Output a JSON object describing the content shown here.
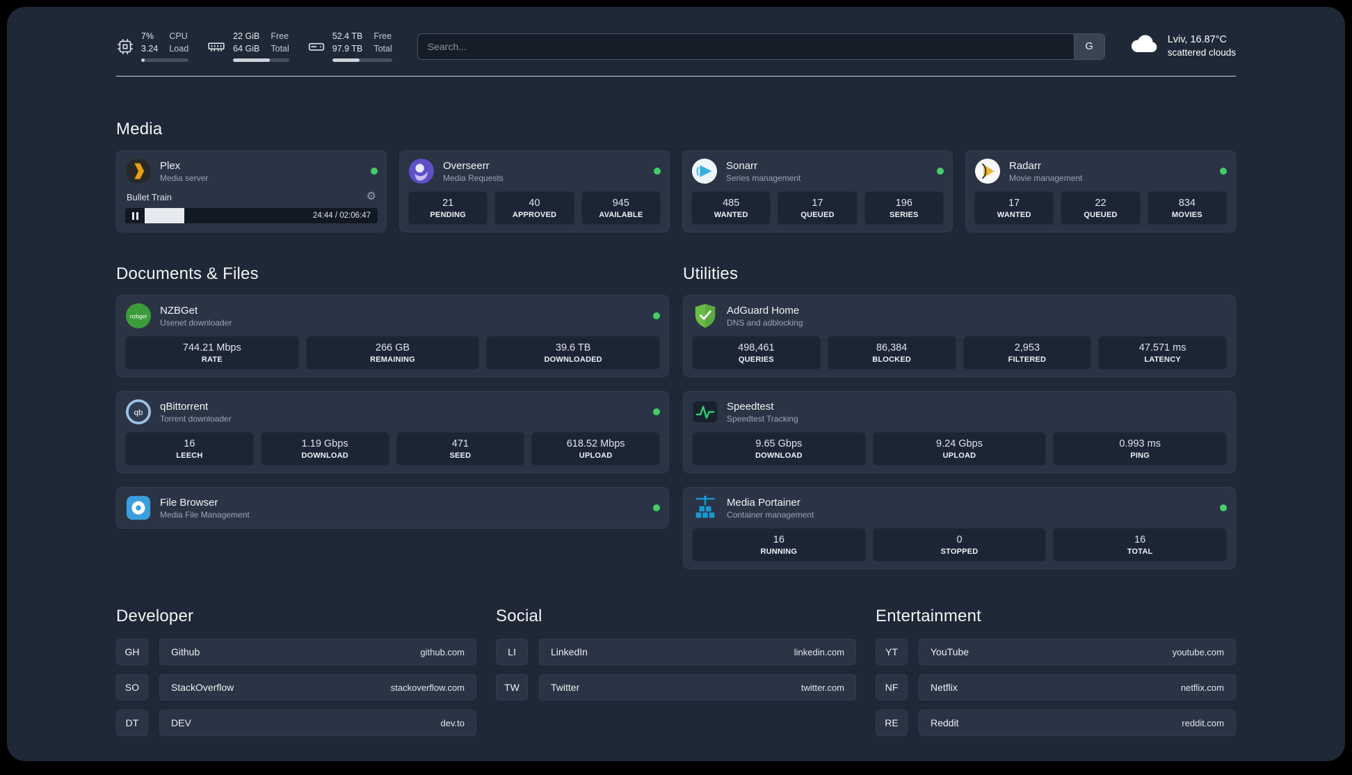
{
  "colors": {
    "page_bg": "#1e2836",
    "card_bg": "#2a3444",
    "tile_bg": "#1c2534",
    "status_green": "#44ce6b",
    "divider": "#cfd4db",
    "plex_gold": "#e5a00d",
    "adguard_green": "#68bc46",
    "portainer_blue": "#1999d4"
  },
  "icons": {
    "gear": "⚙"
  },
  "topbar": {
    "cpu": {
      "line1": "7%",
      "line2": "3.24",
      "label1": "CPU",
      "label2": "Load",
      "progress_pct": 7
    },
    "memory": {
      "line1": "22 GiB",
      "line2": "64 GiB",
      "label1": "Free",
      "label2": "Total",
      "progress_pct": 66
    },
    "disk": {
      "line1": "52.4 TB",
      "line2": "97.9 TB",
      "label1": "Free",
      "label2": "Total",
      "progress_pct": 46
    },
    "search": {
      "placeholder": "Search...",
      "button": "G"
    },
    "weather": {
      "location": "Lviv, 16.87°C",
      "condition": "scattered clouds"
    }
  },
  "sections": {
    "media": {
      "title": "Media",
      "plex": {
        "name": "Plex",
        "desc": "Media server",
        "now_playing": "Bullet Train",
        "time": "24:44 / 02:06:47",
        "progress_pct": 17
      },
      "overseerr": {
        "name": "Overseerr",
        "desc": "Media Requests",
        "stats": [
          {
            "value": "21",
            "label": "PENDING"
          },
          {
            "value": "40",
            "label": "APPROVED"
          },
          {
            "value": "945",
            "label": "AVAILABLE"
          }
        ]
      },
      "sonarr": {
        "name": "Sonarr",
        "desc": "Series management",
        "stats": [
          {
            "value": "485",
            "label": "WANTED"
          },
          {
            "value": "17",
            "label": "QUEUED"
          },
          {
            "value": "196",
            "label": "SERIES"
          }
        ]
      },
      "radarr": {
        "name": "Radarr",
        "desc": "Movie management",
        "stats": [
          {
            "value": "17",
            "label": "WANTED"
          },
          {
            "value": "22",
            "label": "QUEUED"
          },
          {
            "value": "834",
            "label": "MOVIES"
          }
        ]
      }
    },
    "documents": {
      "title": "Documents & Files",
      "nzbget": {
        "name": "NZBGet",
        "desc": "Usenet downloader",
        "stats": [
          {
            "value": "744.21 Mbps",
            "label": "RATE"
          },
          {
            "value": "266 GB",
            "label": "REMAINING"
          },
          {
            "value": "39.6 TB",
            "label": "DOWNLOADED"
          }
        ]
      },
      "qbittorrent": {
        "name": "qBittorrent",
        "desc": "Torrent downloader",
        "stats": [
          {
            "value": "16",
            "label": "LEECH"
          },
          {
            "value": "1.19 Gbps",
            "label": "DOWNLOAD"
          },
          {
            "value": "471",
            "label": "SEED"
          },
          {
            "value": "618.52 Mbps",
            "label": "UPLOAD"
          }
        ]
      },
      "filebrowser": {
        "name": "File Browser",
        "desc": "Media File Management"
      }
    },
    "utilities": {
      "title": "Utilities",
      "adguard": {
        "name": "AdGuard Home",
        "desc": "DNS and adblocking",
        "stats": [
          {
            "value": "498,461",
            "label": "QUERIES"
          },
          {
            "value": "86,384",
            "label": "BLOCKED"
          },
          {
            "value": "2,953",
            "label": "FILTERED"
          },
          {
            "value": "47.571 ms",
            "label": "LATENCY"
          }
        ]
      },
      "speedtest": {
        "name": "Speedtest",
        "desc": "Speedtest Tracking",
        "stats": [
          {
            "value": "9.65 Gbps",
            "label": "DOWNLOAD"
          },
          {
            "value": "9.24 Gbps",
            "label": "UPLOAD"
          },
          {
            "value": "0.993 ms",
            "label": "PING"
          }
        ]
      },
      "portainer": {
        "name": "Media Portainer",
        "desc": "Container management",
        "stats": [
          {
            "value": "16",
            "label": "RUNNING"
          },
          {
            "value": "0",
            "label": "STOPPED"
          },
          {
            "value": "16",
            "label": "TOTAL"
          }
        ]
      }
    },
    "bookmarks": {
      "developer": {
        "title": "Developer",
        "items": [
          {
            "abbr": "GH",
            "name": "Github",
            "url": "github.com"
          },
          {
            "abbr": "SO",
            "name": "StackOverflow",
            "url": "stackoverflow.com"
          },
          {
            "abbr": "DT",
            "name": "DEV",
            "url": "dev.to"
          }
        ]
      },
      "social": {
        "title": "Social",
        "items": [
          {
            "abbr": "LI",
            "name": "LinkedIn",
            "url": "linkedin.com"
          },
          {
            "abbr": "TW",
            "name": "Twitter",
            "url": "twitter.com"
          }
        ]
      },
      "entertainment": {
        "title": "Entertainment",
        "items": [
          {
            "abbr": "YT",
            "name": "YouTube",
            "url": "youtube.com"
          },
          {
            "abbr": "NF",
            "name": "Netflix",
            "url": "netflix.com"
          },
          {
            "abbr": "RE",
            "name": "Reddit",
            "url": "reddit.com"
          }
        ]
      }
    }
  }
}
